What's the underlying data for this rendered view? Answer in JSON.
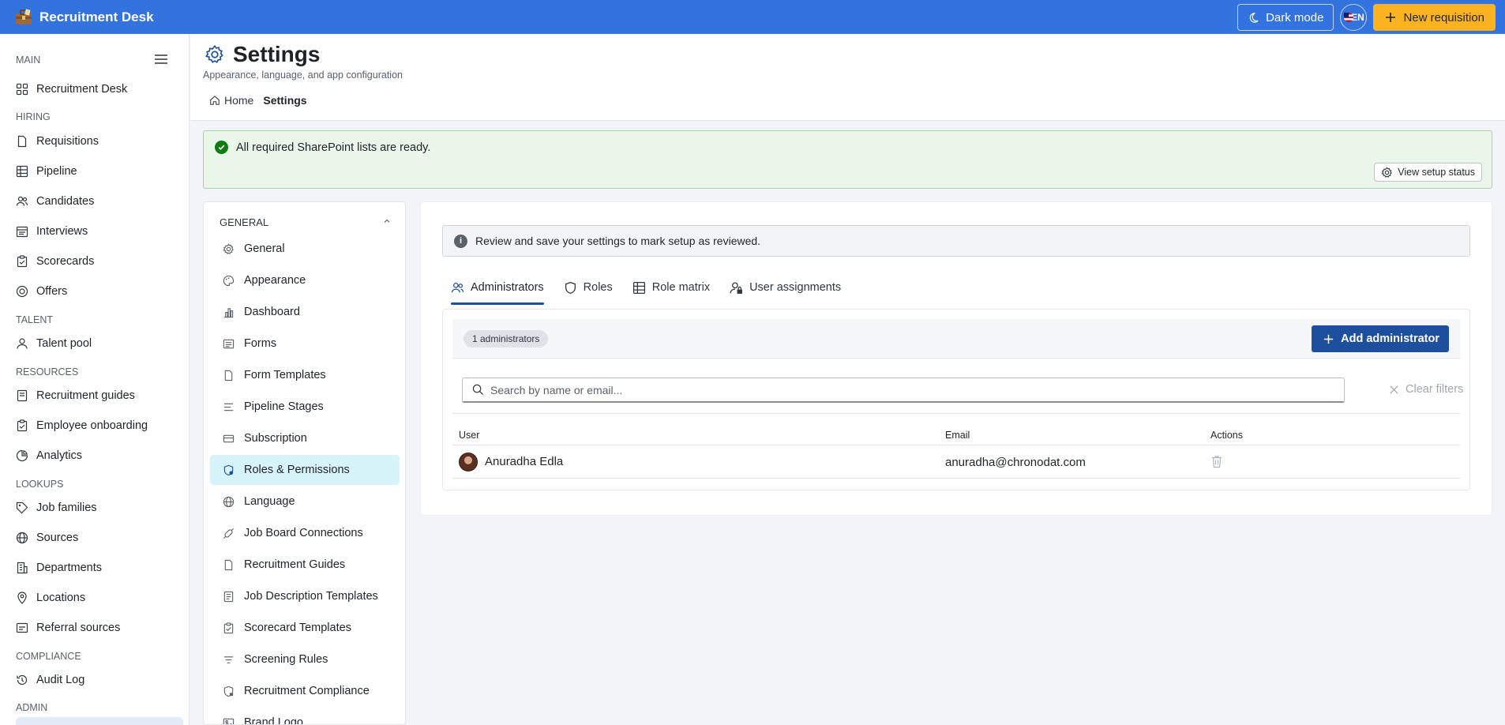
{
  "app": {
    "title": "Recruitment Desk"
  },
  "topbar": {
    "dark_mode_label": "Dark mode",
    "language_code": "EN",
    "new_requisition_label": "New requisition"
  },
  "sidebar": {
    "groups": {
      "main": "MAIN",
      "hiring": "HIRING",
      "talent": "TALENT",
      "resources": "RESOURCES",
      "lookups": "LOOKUPS",
      "compliance": "COMPLIANCE",
      "admin": "ADMIN"
    },
    "items": [
      "Recruitment Desk",
      "Requisitions",
      "Pipeline",
      "Candidates",
      "Interviews",
      "Scorecards",
      "Offers",
      "Talent pool",
      "Recruitment guides",
      "Employee onboarding",
      "Analytics",
      "Job families",
      "Sources",
      "Departments",
      "Locations",
      "Referral sources",
      "Audit Log"
    ]
  },
  "header": {
    "title": "Settings",
    "subtitle": "Appearance, language, and app configuration",
    "breadcrumb": {
      "home": "Home",
      "current": "Settings"
    }
  },
  "status": {
    "message": "All required SharePoint lists are ready.",
    "setup_button": "View setup status"
  },
  "settings_menu": {
    "section": "GENERAL",
    "items": [
      "General",
      "Appearance",
      "Dashboard",
      "Forms",
      "Form Templates",
      "Pipeline Stages",
      "Subscription",
      "Roles & Permissions",
      "Language",
      "Job Board Connections",
      "Recruitment Guides",
      "Job Description Templates",
      "Scorecard Templates",
      "Screening Rules",
      "Recruitment Compliance",
      "Brand Logo"
    ],
    "active": "Roles & Permissions"
  },
  "main": {
    "info": "Review and save your settings to mark setup as reviewed.",
    "tabs": [
      "Administrators",
      "Roles",
      "Role matrix",
      "User assignments"
    ],
    "active_tab": "Administrators",
    "admins": {
      "count_label": "1 administrators",
      "add_button": "Add administrator",
      "search_placeholder": "Search by name or email...",
      "clear_filters": "Clear filters",
      "columns": {
        "user": "User",
        "email": "Email",
        "actions": "Actions"
      },
      "rows": [
        {
          "name": "Anuradha Edla",
          "email": "anuradha@chronodat.com"
        }
      ]
    }
  },
  "colors": {
    "topbar": "#3273e0",
    "accent": "#fbb320",
    "primary_button": "#1e4f9e",
    "success": "#107c10",
    "active_menu": "#d7f4fb"
  }
}
